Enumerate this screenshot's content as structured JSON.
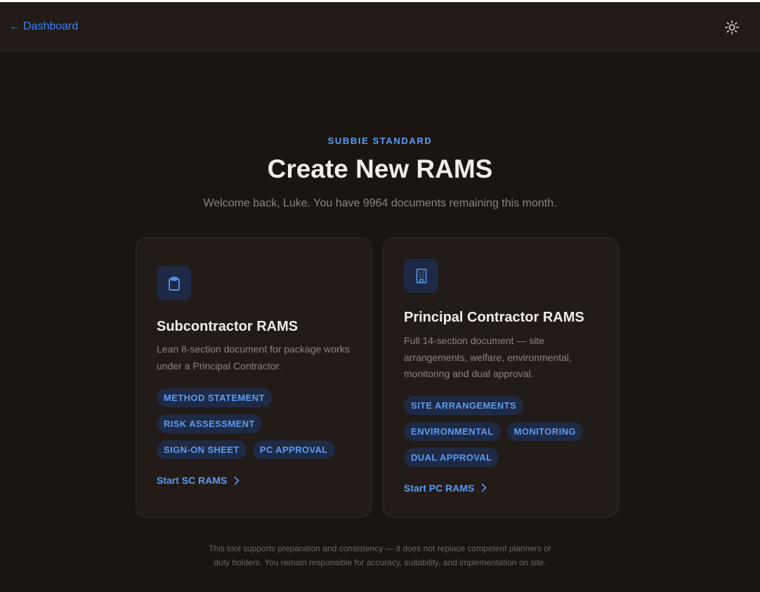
{
  "header": {
    "back_arrow": "←",
    "back_label": "Dashboard"
  },
  "hero": {
    "eyebrow": "SUBBIE STANDARD",
    "title": "Create New RAMS",
    "subtitle": "Welcome back, Luke. You have 9964 documents remaining this month."
  },
  "cards": [
    {
      "icon": "clipboard-icon",
      "title": "Subcontractor RAMS",
      "description": "Lean 8-section document for package works under a Principal Contractor.",
      "tags": [
        "METHOD STATEMENT",
        "RISK ASSESSMENT",
        "SIGN-ON SHEET",
        "PC APPROVAL"
      ],
      "cta": "Start SC RAMS"
    },
    {
      "icon": "building-icon",
      "title": "Principal Contractor RAMS",
      "description": "Full 14-section document — site arrangements, welfare, environmental, monitoring and dual approval.",
      "tags": [
        "SITE ARRANGEMENTS",
        "ENVIRONMENTAL",
        "MONITORING",
        "DUAL APPROVAL"
      ],
      "cta": "Start PC RAMS"
    }
  ],
  "disclaimer": {
    "line1": "This tool supports preparation and consistency — it does not replace competent planners or",
    "line2": "duty holders. You remain responsible for accuracy, suitability, and implementation on site."
  },
  "colors": {
    "background": "#1b1512",
    "card": "#231b17",
    "accent": "#5b9cf5",
    "link": "#3b82f6",
    "tag_bg": "#1f2a44"
  }
}
